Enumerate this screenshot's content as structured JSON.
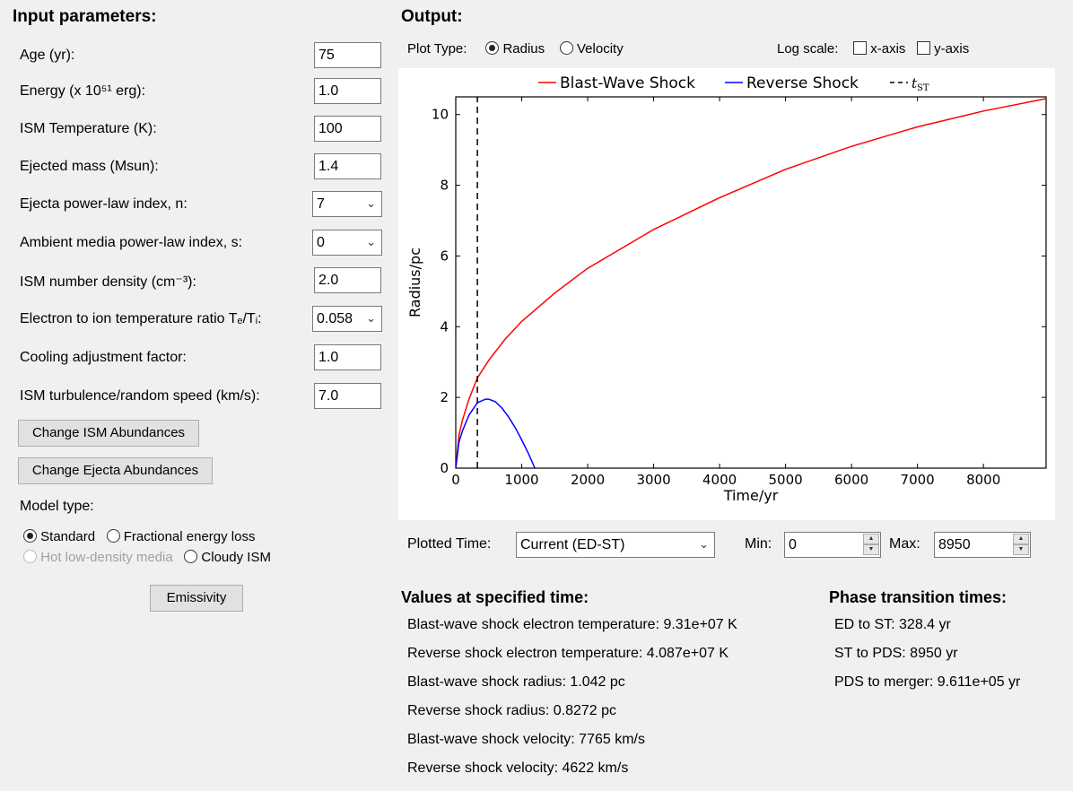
{
  "input": {
    "heading": "Input parameters:",
    "fields": [
      {
        "label": "Age (yr):",
        "value": "75"
      },
      {
        "label": "Energy (x 10⁵¹ erg):",
        "value": "1.0"
      },
      {
        "label": "ISM Temperature (K):",
        "value": "100"
      },
      {
        "label": "Ejected mass (Msun):",
        "value": "1.4"
      },
      {
        "label": "Ejecta power-law index, n:",
        "value": "7"
      },
      {
        "label": "Ambient media power-law index, s:",
        "value": "0"
      },
      {
        "label": "ISM number density (cm⁻³):",
        "value": "2.0"
      },
      {
        "label": "Electron to ion temperature ratio Tₑ/Tᵢ:",
        "value": "0.058"
      },
      {
        "label": "Cooling adjustment factor:",
        "value": "1.0"
      },
      {
        "label": "ISM turbulence/random speed (km/s):",
        "value": "7.0"
      }
    ],
    "ism_abund_button": "Change ISM Abundances",
    "ejecta_abund_button": "Change Ejecta Abundances",
    "model_type_label": "Model type:",
    "model_options": [
      "Standard",
      "Fractional energy loss",
      "Hot low-density media",
      "Cloudy ISM"
    ],
    "emissivity_button": "Emissivity"
  },
  "output": {
    "heading": "Output:",
    "plot_type_label": "Plot Type:",
    "plot_type_options": [
      "Radius",
      "Velocity"
    ],
    "log_scale_label": "Log scale:",
    "log_options": [
      "x-axis",
      "y-axis"
    ],
    "plotted_time_label": "Plotted Time:",
    "plotted_time_value": "Current (ED-ST)",
    "min_label": "Min:",
    "min_value": "0",
    "max_label": "Max:",
    "max_value": "8950"
  },
  "values": {
    "heading": "Values at specified time:",
    "lines": [
      "Blast-wave shock electron temperature:  9.31e+07 K",
      "Reverse shock electron temperature:  4.087e+07 K",
      "Blast-wave shock radius:  1.042 pc",
      "Reverse shock radius:  0.8272 pc",
      "Blast-wave shock velocity:  7765 km/s",
      "Reverse shock velocity:  4622 km/s"
    ]
  },
  "phase": {
    "heading": "Phase transition times:",
    "lines": [
      "ED to ST:  328.4 yr",
      "ST to PDS:  8950 yr",
      "PDS to merger:  9.611e+05 yr"
    ]
  },
  "chart_data": {
    "type": "line",
    "xlabel": "Time/yr",
    "ylabel": "Radius/pc",
    "xlim": [
      0,
      8950
    ],
    "ylim": [
      0,
      10.5
    ],
    "xticks": [
      0,
      1000,
      2000,
      3000,
      4000,
      5000,
      6000,
      7000,
      8000
    ],
    "yticks": [
      0,
      2,
      4,
      6,
      8,
      10
    ],
    "legend_position": "top",
    "series": [
      {
        "name": "Blast-Wave Shock",
        "color": "#ff0000",
        "x": [
          0,
          50,
          100,
          200,
          328.4,
          500,
          750,
          1000,
          1500,
          2000,
          3000,
          4000,
          5000,
          6000,
          7000,
          8000,
          8950
        ],
        "y": [
          0,
          0.95,
          1.35,
          1.95,
          2.55,
          3.05,
          3.65,
          4.15,
          4.95,
          5.65,
          6.75,
          7.65,
          8.45,
          9.1,
          9.65,
          10.1,
          10.45
        ]
      },
      {
        "name": "Reverse Shock",
        "color": "#0000ff",
        "x": [
          0,
          50,
          100,
          200,
          328.4,
          450,
          500,
          600,
          700,
          800,
          900,
          1000,
          1100,
          1200
        ],
        "y": [
          0,
          0.75,
          1.05,
          1.5,
          1.85,
          1.95,
          1.95,
          1.88,
          1.7,
          1.45,
          1.15,
          0.8,
          0.42,
          0
        ]
      },
      {
        "name": "t_ST",
        "color": "#000000",
        "style": "dashed",
        "x": [
          328.4,
          328.4
        ],
        "y": [
          0,
          10.5
        ]
      }
    ],
    "legend": [
      "Blast-Wave Shock",
      "Reverse Shock",
      "t_ST"
    ]
  }
}
